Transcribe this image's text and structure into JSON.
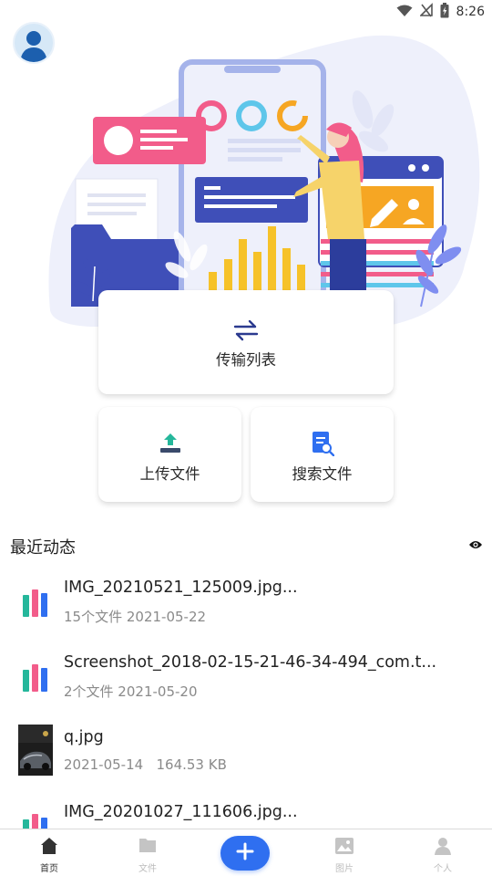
{
  "status_bar": {
    "time": "8:26",
    "icons": [
      "wifi-icon",
      "no-sim-icon",
      "battery-charging-icon"
    ]
  },
  "header": {
    "avatar_icon": "user-avatar-icon"
  },
  "actions": {
    "transfer": {
      "label": "传输列表",
      "icon": "swap-arrows-icon"
    },
    "upload": {
      "label": "上传文件",
      "icon": "upload-tray-icon"
    },
    "search": {
      "label": "搜索文件",
      "icon": "file-search-icon"
    }
  },
  "recent": {
    "title": "最近动态",
    "toggle_icon": "eye-icon",
    "items": [
      {
        "title": "IMG_20210521_125009.jpg...",
        "meta": "15个文件 2021-05-22",
        "thumb": "image-stack-icon"
      },
      {
        "title": "Screenshot_2018-02-15-21-46-34-494_com.t...",
        "meta": "2个文件 2021-05-20",
        "thumb": "image-stack-icon"
      },
      {
        "title": "q.jpg",
        "meta": "2021-05-14   164.53 KB",
        "thumb": "photo-thumbnail"
      },
      {
        "title": "IMG_20201027_111606.jpg...",
        "meta": "",
        "thumb": "image-stack-icon"
      }
    ]
  },
  "bottom_nav": {
    "items": [
      {
        "label": "首页",
        "icon": "home-icon",
        "active": true
      },
      {
        "label": "文件",
        "icon": "folder-icon",
        "active": false
      },
      {
        "label": "",
        "icon": "plus-icon",
        "active": false
      },
      {
        "label": "图片",
        "icon": "image-icon",
        "active": false
      },
      {
        "label": "个人",
        "icon": "person-icon",
        "active": false
      }
    ]
  },
  "colors": {
    "accent": "#2f6ff0",
    "illustration_blue": "#3f4fb8",
    "illustration_pink": "#f25c8a",
    "illustration_yellow": "#f6c229",
    "muted_text": "#8a8a8a"
  }
}
